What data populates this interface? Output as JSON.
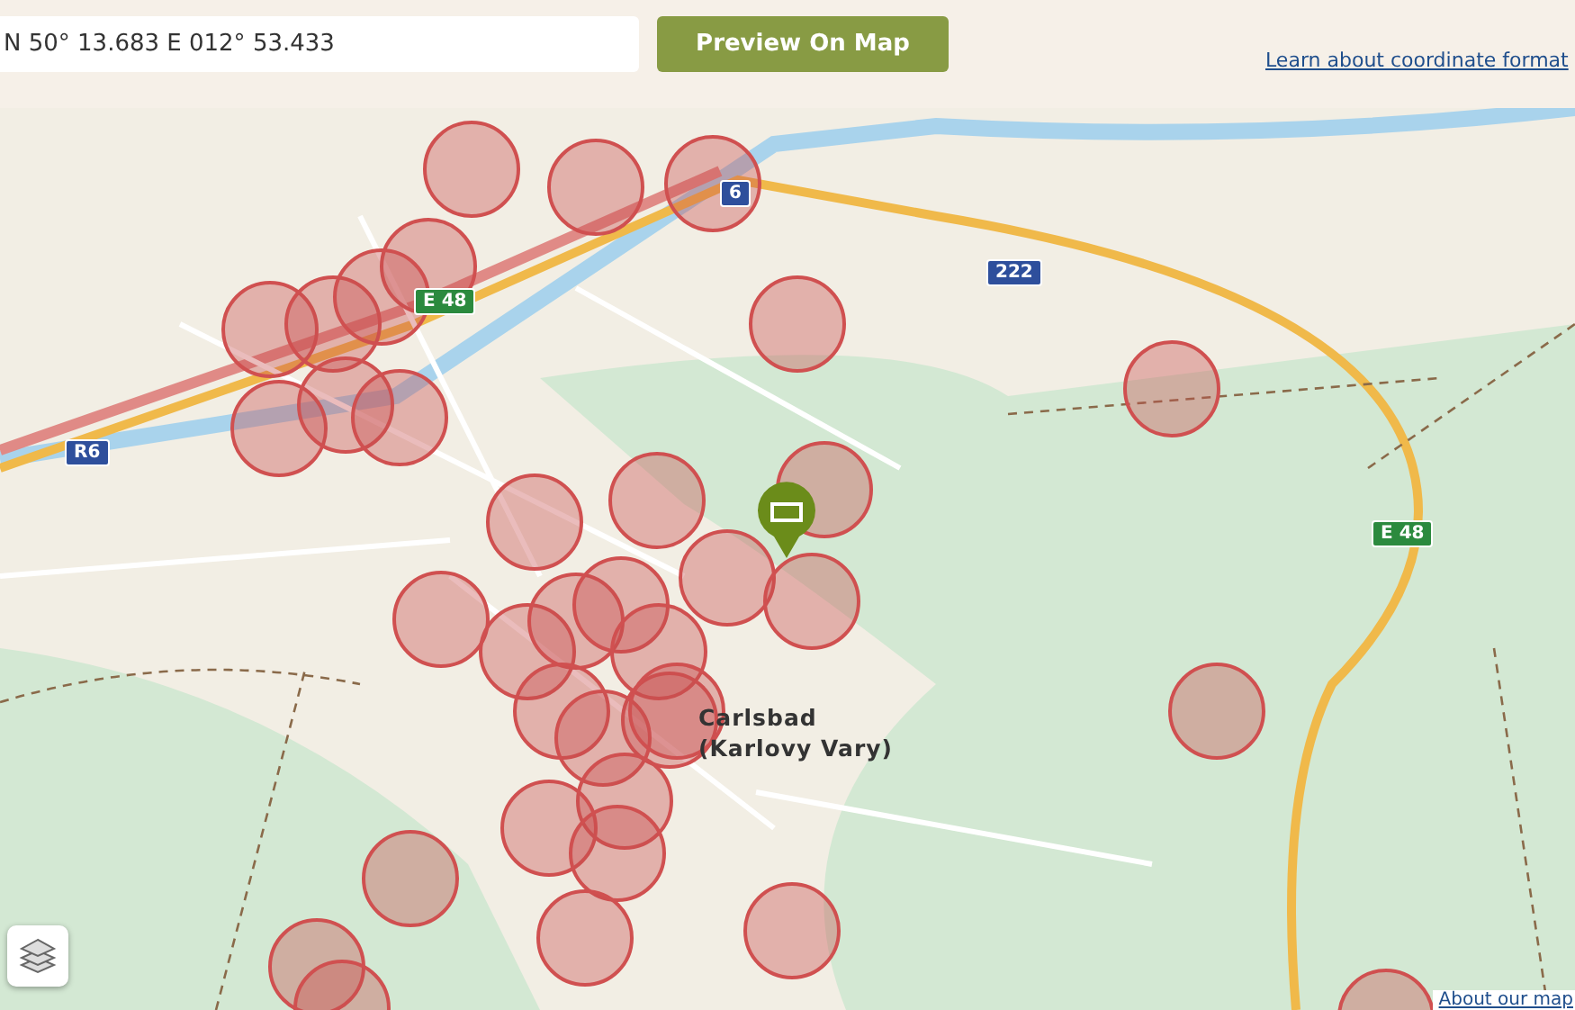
{
  "search": {
    "value": "N 50° 13.683 E 012° 53.433"
  },
  "preview_button": {
    "label": "Preview On Map"
  },
  "learn_link": {
    "label": "Learn about coordinate format"
  },
  "map": {
    "city_label": [
      "Carlsbad",
      "(Karlovy Vary)"
    ],
    "road_badges": [
      {
        "label": "6",
        "kind": "blue"
      },
      {
        "label": "E 48",
        "kind": "green"
      },
      {
        "label": "222",
        "kind": "blue"
      },
      {
        "label": "R6",
        "kind": "blue"
      },
      {
        "label": "E 48",
        "kind": "green"
      }
    ],
    "about_link": {
      "label": "About our map"
    }
  }
}
